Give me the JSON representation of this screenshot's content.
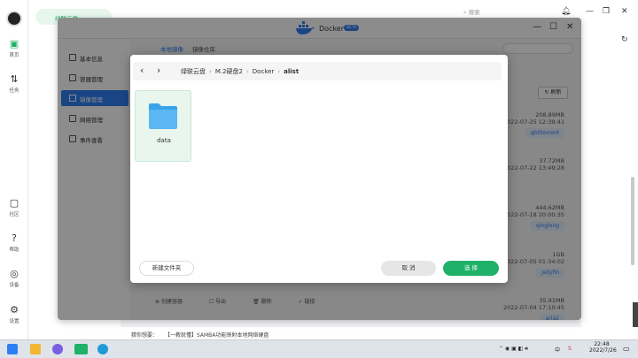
{
  "left_rail": {
    "items": [
      {
        "label": "首页",
        "icon": "home-icon"
      },
      {
        "label": "任务",
        "icon": "transfer-icon"
      },
      {
        "label": "社区",
        "icon": "chat-icon"
      },
      {
        "label": "帮助",
        "icon": "help-icon"
      },
      {
        "label": "设备",
        "icon": "device-icon"
      },
      {
        "label": "设置",
        "icon": "gear-icon"
      }
    ]
  },
  "nav": {
    "top_item": "绿联云盘"
  },
  "topbar": {
    "search_placeholder": "搜索"
  },
  "docker": {
    "title": "Docker",
    "badge": "BETA",
    "sidebar": [
      {
        "label": "基本信息"
      },
      {
        "label": "容器管理"
      },
      {
        "label": "镜像管理"
      },
      {
        "label": "网络管理"
      },
      {
        "label": "事件查看"
      }
    ],
    "tabs": [
      "本地镜像",
      "镜像仓库"
    ],
    "refresh_label": "刷新",
    "images": [
      {
        "size": "208.89MB",
        "date": "2022-07-25 12:39:41",
        "name": "qbittorrent"
      },
      {
        "size": "37.72MB",
        "date": "2022-07-22 13:49:28",
        "name": ""
      },
      {
        "size": "444.62MB",
        "date": "2022-07-18 20:00:35",
        "name": "qinglong"
      },
      {
        "size": "1GB",
        "date": "2022-07-05 01:34:02",
        "name": "jellyfin"
      },
      {
        "size": "35.91MB",
        "date": "2022-07-04 17:10:45",
        "name": "aria2"
      }
    ],
    "footer_actions": [
      "创建容器",
      "导出",
      "删除",
      "链接"
    ]
  },
  "picker": {
    "breadcrumb": [
      "绿联云盘",
      "M.2硬盘2",
      "Docker",
      "alist"
    ],
    "folders": [
      {
        "name": "data"
      }
    ],
    "new_folder_label": "新建文件夹",
    "cancel_label": "取 消",
    "select_label": "选 择"
  },
  "status_bar": {
    "hint": "猜你想要：",
    "link": "【一教就懂】SAMBA功能映射本地网络硬盘"
  },
  "taskbar": {
    "time": "22:48",
    "date": "2022/7/26",
    "lang": "中"
  },
  "colors": {
    "accent_green": "#1fb167",
    "accent_blue": "#2e7ef2"
  }
}
